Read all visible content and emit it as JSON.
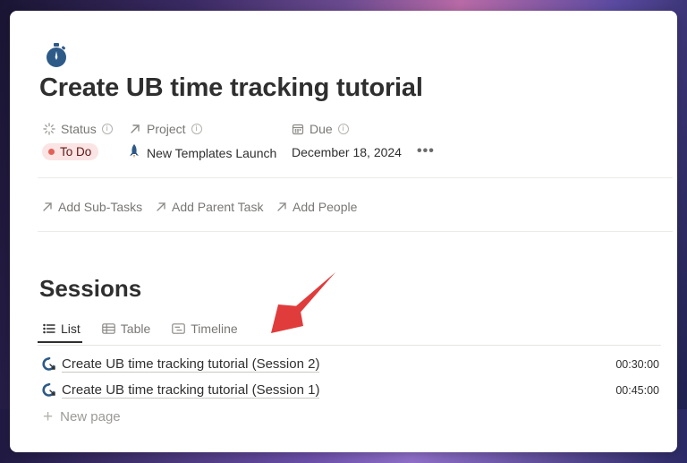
{
  "page": {
    "icon": "stopwatch-icon",
    "title": "Create UB time tracking tutorial"
  },
  "properties": {
    "status": {
      "label": "Status",
      "icon": "status-spinner-icon",
      "value": "To Do"
    },
    "project": {
      "label": "Project",
      "icon": "relation-arrow-icon",
      "value": "New Templates Launch",
      "value_icon": "rocket-icon"
    },
    "due": {
      "label": "Due",
      "icon": "calendar-icon",
      "value": "December 18, 2024"
    },
    "more": "•••"
  },
  "relations": [
    {
      "label": "Add Sub-Tasks"
    },
    {
      "label": "Add Parent Task"
    },
    {
      "label": "Add People"
    }
  ],
  "sessions": {
    "heading": "Sessions",
    "tabs": [
      {
        "label": "List",
        "icon": "list-icon",
        "active": true
      },
      {
        "label": "Table",
        "icon": "table-icon",
        "active": false
      },
      {
        "label": "Timeline",
        "icon": "timeline-icon",
        "active": false
      }
    ],
    "rows": [
      {
        "title": "Create UB time tracking tutorial (Session 2)",
        "duration": "00:30:00"
      },
      {
        "title": "Create UB time tracking tutorial (Session 1)",
        "duration": "00:45:00"
      }
    ],
    "new_page": "New page"
  },
  "colors": {
    "status_bg": "#fbe4e4",
    "status_dot": "#e16259",
    "annotation_arrow": "#e03c3c",
    "icon_blue": "#2e5a88"
  }
}
